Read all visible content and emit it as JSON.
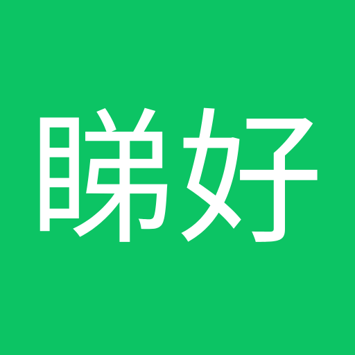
{
  "app_icon": {
    "label": "睇好",
    "background_color": "#0CC464",
    "text_color": "#FFFFFF"
  }
}
